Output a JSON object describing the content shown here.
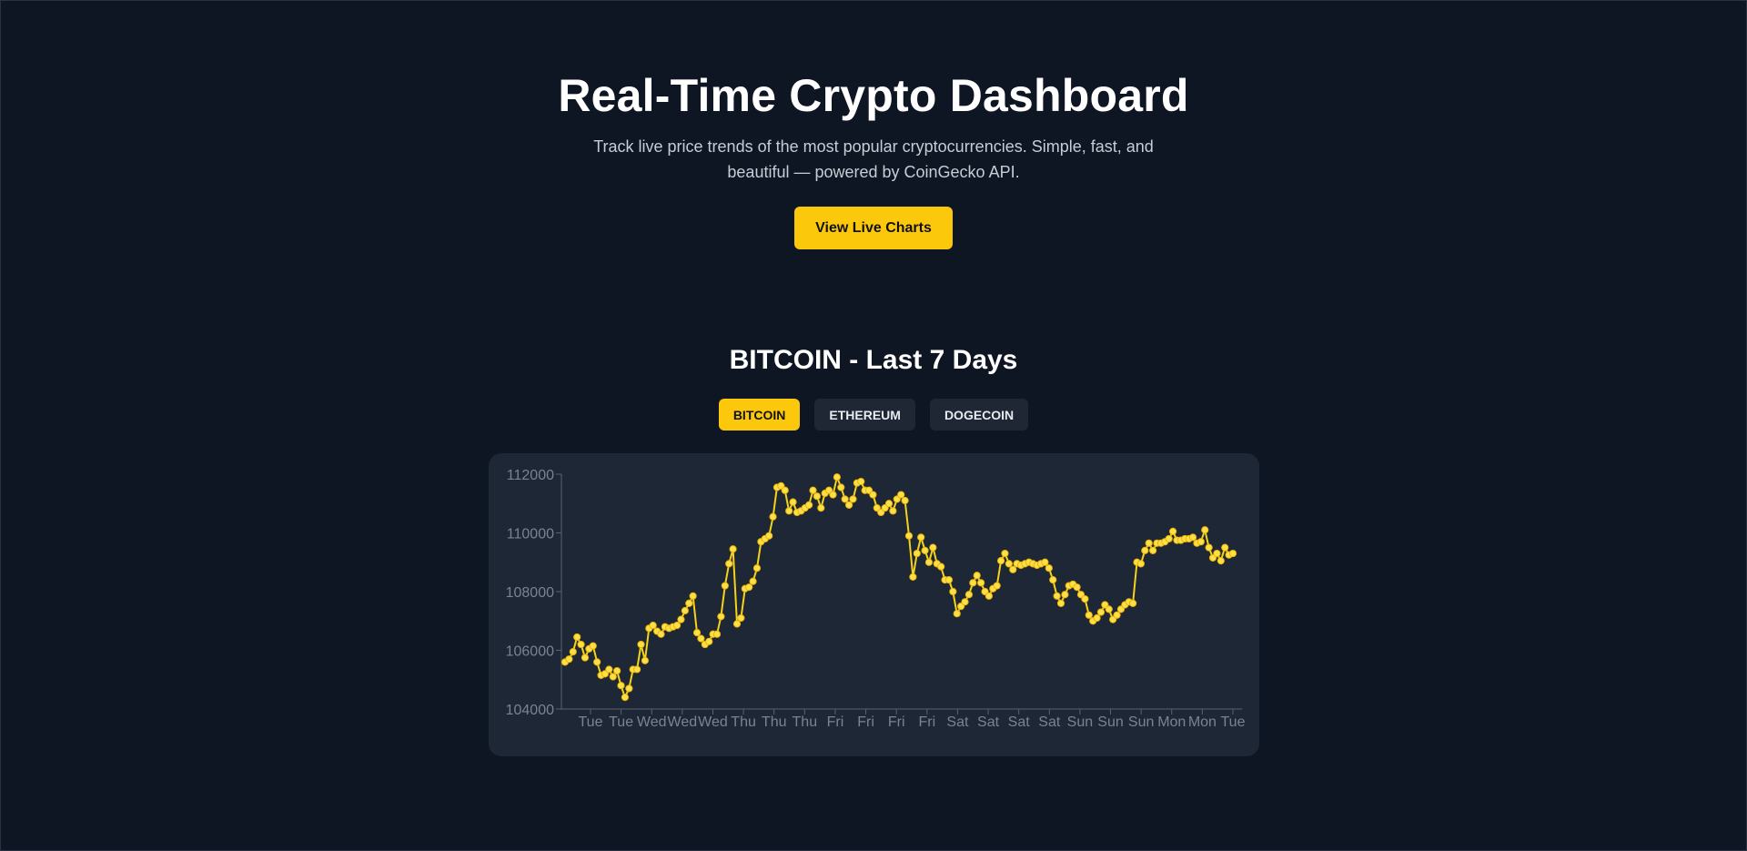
{
  "hero": {
    "title": "Real-Time Crypto Dashboard",
    "subtitle": "Track live price trends of the most popular cryptocurrencies. Simple, fast, and beautiful — powered by CoinGecko API.",
    "cta_label": "View Live Charts"
  },
  "chart_section": {
    "heading": "BITCOIN - Last 7 Days",
    "tabs": [
      {
        "label": "BITCOIN",
        "active": true
      },
      {
        "label": "ETHEREUM",
        "active": false
      },
      {
        "label": "DOGECOIN",
        "active": false
      }
    ]
  },
  "colors": {
    "background": "#0f1623",
    "card": "#1e2736",
    "accent": "#fcc80c",
    "line": "#f5d31a",
    "axis_text": "#7c8390"
  },
  "chart_data": {
    "type": "line",
    "title": "",
    "xlabel": "",
    "ylabel": "",
    "ylim": [
      104000,
      112000
    ],
    "yticks": [
      104000,
      106000,
      108000,
      110000,
      112000
    ],
    "xticks": [
      "Tue",
      "Tue",
      "Wed",
      "Wed",
      "Wed",
      "Thu",
      "Thu",
      "Thu",
      "Fri",
      "Fri",
      "Fri",
      "Fri",
      "Sat",
      "Sat",
      "Sat",
      "Sat",
      "Sun",
      "Sun",
      "Sun",
      "Mon",
      "Mon",
      "Tue"
    ],
    "grid": false,
    "legend": "none",
    "series": [
      {
        "values": [
          105600,
          105700,
          105950,
          106450,
          106200,
          105750,
          106050,
          106150,
          105600,
          105150,
          105200,
          105350,
          105100,
          105300,
          104800,
          104400,
          104700,
          105350,
          105350,
          106200,
          105650,
          106750,
          106850,
          106650,
          106550,
          106800,
          106750,
          106800,
          106850,
          107050,
          107350,
          107600,
          107850,
          106600,
          106400,
          106200,
          106300,
          106550,
          106550,
          107150,
          108200,
          108950,
          109450,
          106900,
          107100,
          108100,
          108150,
          108350,
          108800,
          109700,
          109800,
          109900,
          110550,
          111550,
          111600,
          111450,
          110750,
          111050,
          110700,
          110750,
          110850,
          110950,
          111450,
          111250,
          110850,
          111350,
          111450,
          111300,
          111900,
          111550,
          111150,
          110950,
          111150,
          111700,
          111750,
          111450,
          111450,
          111300,
          110850,
          110700,
          110850,
          111000,
          110750,
          111150,
          111300,
          111100,
          109900,
          108500,
          109300,
          109850,
          109400,
          109000,
          109500,
          108950,
          108850,
          108400,
          108400,
          108000,
          107250,
          107500,
          107650,
          107900,
          108300,
          108550,
          108300,
          108000,
          107850,
          108100,
          108200,
          109050,
          109300,
          108950,
          108750,
          108950,
          108900,
          108950,
          109000,
          108950,
          108900,
          108950,
          109000,
          108800,
          108400,
          107850,
          107600,
          107900,
          108200,
          108250,
          108150,
          107900,
          107750,
          107200,
          107000,
          107100,
          107300,
          107550,
          107400,
          107050,
          107200,
          107400,
          107550,
          107650,
          107600,
          109000,
          108950,
          109400,
          109650,
          109400,
          109650,
          109650,
          109700,
          109800,
          110050,
          109750,
          109750,
          109800,
          109800,
          109850,
          109650,
          109700,
          110100,
          109500,
          109150,
          109300,
          109050,
          109500,
          109250,
          109300
        ]
      }
    ]
  }
}
